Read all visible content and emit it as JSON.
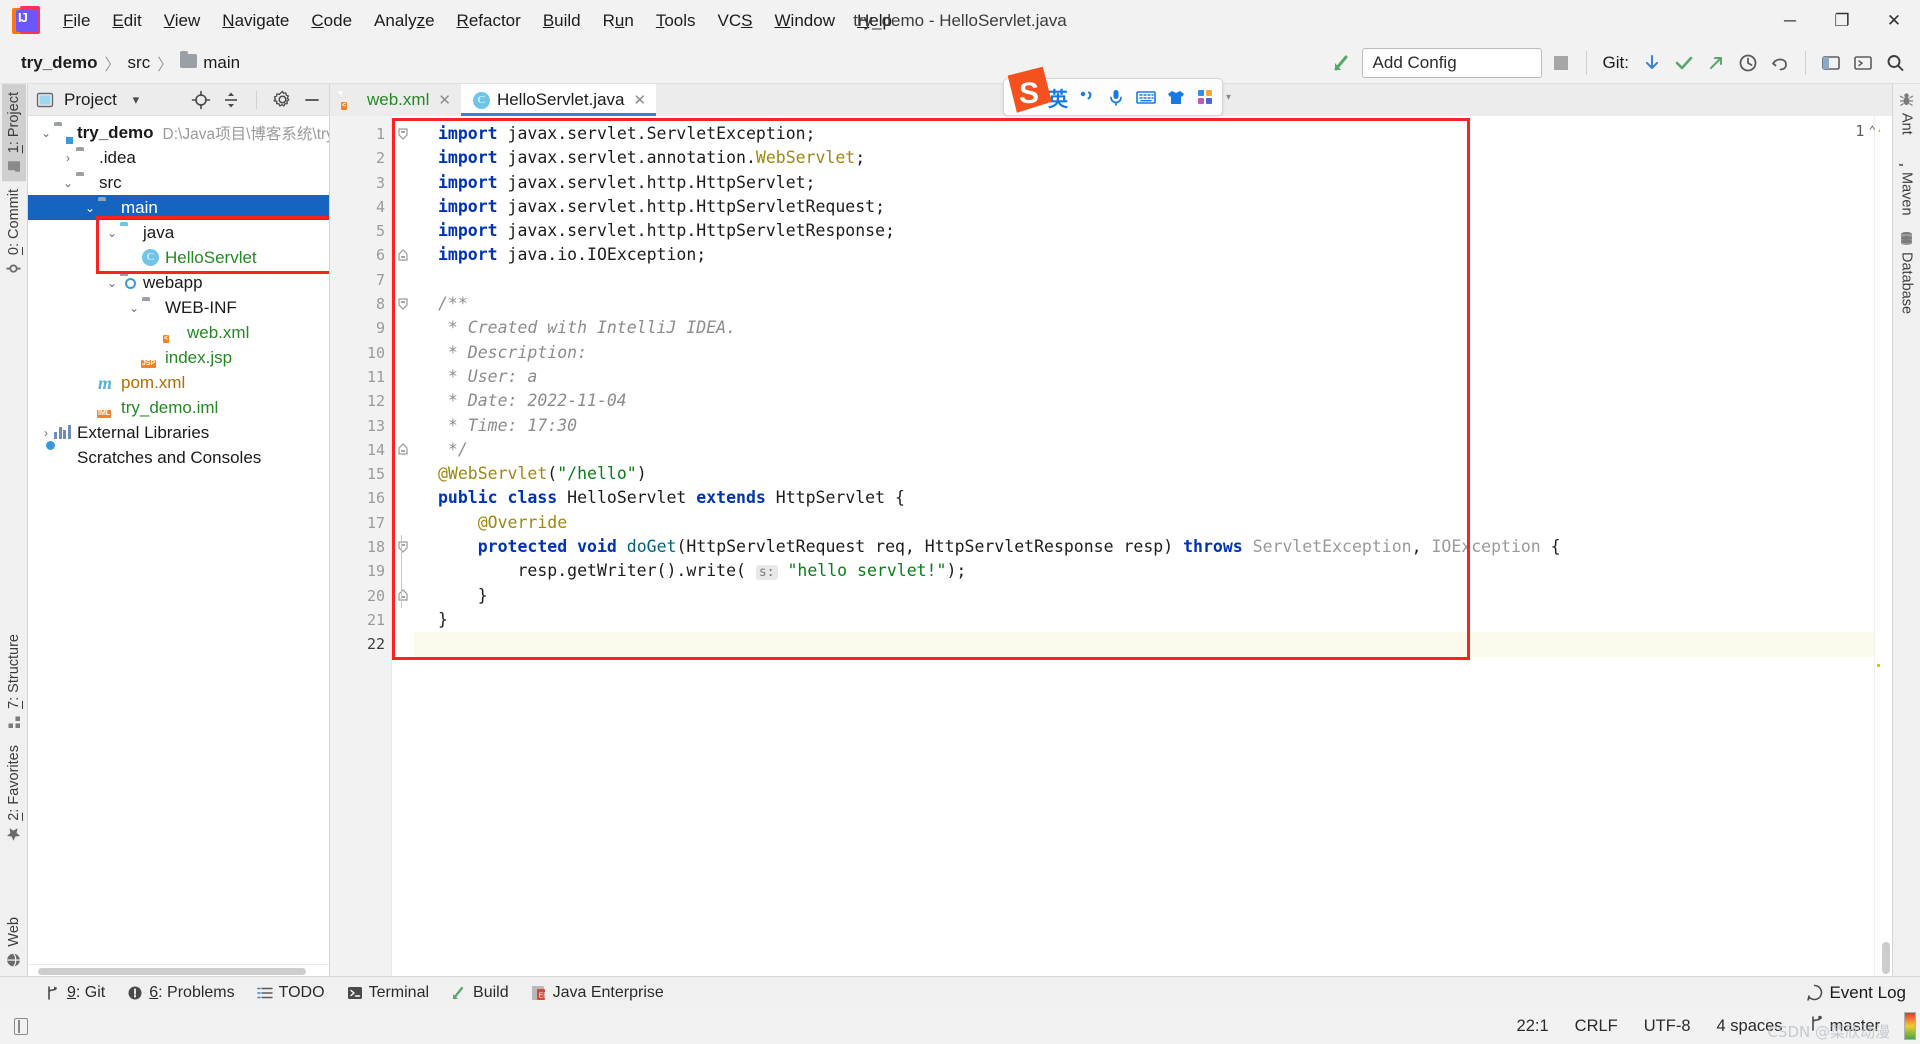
{
  "window": {
    "title": "try_demo - HelloServlet.java",
    "logo_text": "IJ",
    "minimize": "─",
    "maximize": "❐",
    "close": "✕"
  },
  "menu": [
    {
      "pre": "",
      "mn": "F",
      "post": "ile"
    },
    {
      "pre": "",
      "mn": "E",
      "post": "dit"
    },
    {
      "pre": "",
      "mn": "V",
      "post": "iew"
    },
    {
      "pre": "",
      "mn": "N",
      "post": "avigate"
    },
    {
      "pre": "",
      "mn": "C",
      "post": "ode"
    },
    {
      "pre": "Analy",
      "mn": "z",
      "post": "e"
    },
    {
      "pre": "",
      "mn": "R",
      "post": "efactor"
    },
    {
      "pre": "",
      "mn": "B",
      "post": "uild"
    },
    {
      "pre": "R",
      "mn": "u",
      "post": "n"
    },
    {
      "pre": "",
      "mn": "T",
      "post": "ools"
    },
    {
      "pre": "VC",
      "mn": "S",
      "post": ""
    },
    {
      "pre": "",
      "mn": "W",
      "post": "indow"
    },
    {
      "pre": "",
      "mn": "H",
      "post": "elp"
    }
  ],
  "breadcrumb": {
    "project": "try_demo",
    "sep": "〉",
    "src": "src",
    "main": "main"
  },
  "toolbar": {
    "run_config_label": "Add Config",
    "git_label": "Git:"
  },
  "ime": {
    "logo_text": "S",
    "lang": "英",
    "punct": "•,",
    "mic": "mic",
    "keyboard": "keyboard",
    "skin": "skin",
    "apps": "apps",
    "caret": "▾"
  },
  "left_strip": [
    {
      "label": "1: Project",
      "underline": "1",
      "icon": "folder-icon",
      "active": true
    },
    {
      "label": "0: Commit",
      "underline": "0",
      "icon": "commit-icon",
      "active": false
    },
    {
      "label": "7: Structure",
      "underline": "7",
      "icon": "structure-icon",
      "active": false
    },
    {
      "label": "2: Favorites",
      "underline": "2",
      "icon": "star-icon",
      "active": false
    },
    {
      "label": "Web",
      "underline": "",
      "icon": "globe-icon",
      "active": false
    }
  ],
  "right_strip": [
    {
      "label": "Ant",
      "icon": "ant-icon"
    },
    {
      "label": "Maven",
      "icon": "maven-icon"
    },
    {
      "label": "Database",
      "icon": "database-icon"
    }
  ],
  "project_panel": {
    "title": "Project",
    "caret": "▾",
    "locate_icon": "locate-icon",
    "collapse_icon": "collapse-all-icon",
    "settings_icon": "gear-icon",
    "hide_icon": "hide-icon",
    "tree": [
      {
        "indent": 0,
        "arrow": "⌄",
        "icon": "module",
        "label": "try_demo",
        "bold": true,
        "path": "D:\\Java项目\\博客系统\\try_",
        "selected": false,
        "color": ""
      },
      {
        "indent": 1,
        "arrow": "›",
        "icon": "folder",
        "label": ".idea",
        "bold": false,
        "path": "",
        "selected": false,
        "color": ""
      },
      {
        "indent": 1,
        "arrow": "⌄",
        "icon": "folder",
        "label": "src",
        "bold": false,
        "path": "",
        "selected": false,
        "color": ""
      },
      {
        "indent": 2,
        "arrow": "⌄",
        "icon": "folder",
        "label": "main",
        "bold": false,
        "path": "",
        "selected": true,
        "color": ""
      },
      {
        "indent": 3,
        "arrow": "⌄",
        "icon": "folder-blue",
        "label": "java",
        "bold": false,
        "path": "",
        "selected": false,
        "color": ""
      },
      {
        "indent": 4,
        "arrow": "",
        "icon": "class",
        "label": "HelloServlet",
        "bold": false,
        "path": "",
        "selected": false,
        "color": "green"
      },
      {
        "indent": 3,
        "arrow": "⌄",
        "icon": "webapp",
        "label": "webapp",
        "bold": false,
        "path": "",
        "selected": false,
        "color": ""
      },
      {
        "indent": 4,
        "arrow": "⌄",
        "icon": "folder",
        "label": "WEB-INF",
        "bold": false,
        "path": "",
        "selected": false,
        "color": ""
      },
      {
        "indent": 5,
        "arrow": "",
        "icon": "xml",
        "label": "web.xml",
        "bold": false,
        "path": "",
        "selected": false,
        "color": "green"
      },
      {
        "indent": 4,
        "arrow": "",
        "icon": "jsp",
        "label": "index.jsp",
        "bold": false,
        "path": "",
        "selected": false,
        "color": "green"
      },
      {
        "indent": 2,
        "arrow": "",
        "icon": "maven",
        "label": "pom.xml",
        "bold": false,
        "path": "",
        "selected": false,
        "color": "orange"
      },
      {
        "indent": 2,
        "arrow": "",
        "icon": "iml",
        "label": "try_demo.iml",
        "bold": false,
        "path": "",
        "selected": false,
        "color": "green"
      },
      {
        "indent": 0,
        "arrow": "›",
        "icon": "library",
        "label": "External Libraries",
        "bold": false,
        "path": "",
        "selected": false,
        "color": ""
      },
      {
        "indent": 0,
        "arrow": "",
        "icon": "scratch",
        "label": "Scratches and Consoles",
        "bold": false,
        "path": "",
        "selected": false,
        "color": ""
      }
    ]
  },
  "editor": {
    "tabs": [
      {
        "label": "web.xml",
        "icon": "xml-file-icon",
        "active": false,
        "color": "green"
      },
      {
        "label": "HelloServlet.java",
        "icon": "java-class-icon",
        "active": true,
        "color": ""
      }
    ],
    "inspection_count": "1",
    "inspection_up": "⌃",
    "inspection_down": "⌄",
    "total_lines": 22,
    "current_line": 22,
    "code_lines": [
      {
        "n": 1,
        "html": "<span class=\"kw\">import</span> javax.servlet.ServletException;"
      },
      {
        "n": 2,
        "html": "<span class=\"kw\">import</span> javax.servlet.annotation.<span class=\"ann\">WebServlet</span>;"
      },
      {
        "n": 3,
        "html": "<span class=\"kw\">import</span> javax.servlet.http.HttpServlet;"
      },
      {
        "n": 4,
        "html": "<span class=\"kw\">import</span> javax.servlet.http.HttpServletRequest;"
      },
      {
        "n": 5,
        "html": "<span class=\"kw\">import</span> javax.servlet.http.HttpServletResponse;"
      },
      {
        "n": 6,
        "html": "<span class=\"kw\">import</span> java.io.IOException;"
      },
      {
        "n": 7,
        "html": ""
      },
      {
        "n": 8,
        "html": "<span class=\"cmt\">/**</span>"
      },
      {
        "n": 9,
        "html": "<span class=\"cmt\"> * Created with IntelliJ IDEA.</span>"
      },
      {
        "n": 10,
        "html": "<span class=\"cmt\"> * Description:</span>"
      },
      {
        "n": 11,
        "html": "<span class=\"cmt\"> * User: a</span>"
      },
      {
        "n": 12,
        "html": "<span class=\"cmt\"> * Date: 2022-11-04</span>"
      },
      {
        "n": 13,
        "html": "<span class=\"cmt\"> * Time: 17:30</span>"
      },
      {
        "n": 14,
        "html": "<span class=\"cmt\"> */</span>"
      },
      {
        "n": 15,
        "html": "<span class=\"ann\">@WebServlet</span>(<span class=\"str\">\"/hello\"</span>)"
      },
      {
        "n": 16,
        "html": "<span class=\"kw\">public</span> <span class=\"kw\">class</span> HelloServlet <span class=\"kw\">extends</span> HttpServlet {"
      },
      {
        "n": 17,
        "html": "    <span class=\"ann\">@Override</span>"
      },
      {
        "n": 18,
        "html": "    <span class=\"kw\">protected</span> <span class=\"kw\">void</span> <span class=\"fn\">doGet</span>(HttpServletRequest req, HttpServletResponse resp) <span class=\"kw\">throws</span> <span class=\"type-gray\">ServletException</span>, <span class=\"type-gray\">IOException</span> {"
      },
      {
        "n": 19,
        "html": "        resp.getWriter().write( <span class=\"hint\">s:</span> <span class=\"str\">\"hello servlet!\"</span>);"
      },
      {
        "n": 20,
        "html": "    }"
      },
      {
        "n": 21,
        "html": "}"
      },
      {
        "n": 22,
        "html": ""
      }
    ]
  },
  "bottom_bar": [
    {
      "label": "9: Git",
      "underline": "9",
      "icon": "git-branch-icon"
    },
    {
      "label": "6: Problems",
      "underline": "6",
      "icon": "problems-icon"
    },
    {
      "label": "TODO",
      "underline": "",
      "icon": "todo-icon"
    },
    {
      "label": "Terminal",
      "underline": "",
      "icon": "terminal-icon"
    },
    {
      "label": "Build",
      "underline": "",
      "icon": "build-icon"
    },
    {
      "label": "Java Enterprise",
      "underline": "",
      "icon": "java-enterprise-icon"
    }
  ],
  "event_log": {
    "label": "Event Log",
    "icon": "event-log-icon"
  },
  "status_bar": {
    "caret_position": "22:1",
    "line_separator": "CRLF",
    "encoding": "UTF-8",
    "indent": "4 spaces",
    "branch": "master",
    "branch_icon": "git-branch-icon",
    "watermark": "CSDN @菜欣动漫"
  },
  "colors": {
    "accent_blue": "#1565c0",
    "annotation_red": "#fc2222",
    "keyword": "#0033b3",
    "string": "#067d17",
    "comment": "#8c8c8c",
    "annotation_gold": "#9e880d",
    "ime_blue": "#1879e6",
    "ime_orange": "#f4511e"
  }
}
